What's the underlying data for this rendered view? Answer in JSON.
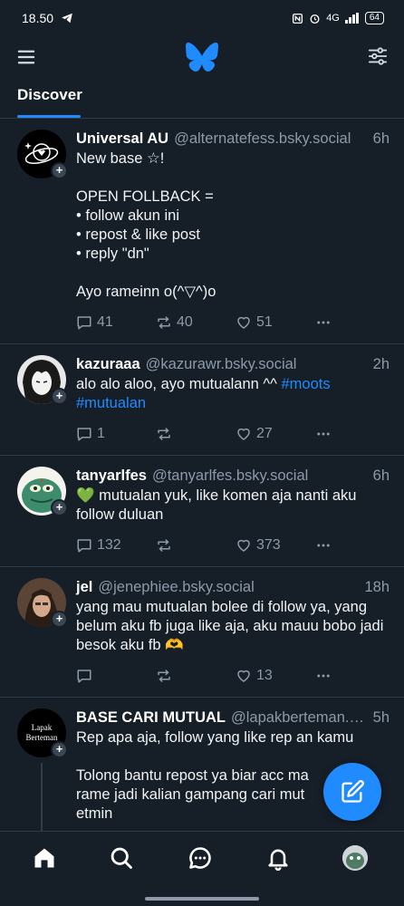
{
  "status_bar": {
    "time": "18.50",
    "network": "4G",
    "battery": "64"
  },
  "header": {
    "menu_icon": "hamburger-menu-icon",
    "logo": "butterfly-logo",
    "filter_icon": "sliders-icon"
  },
  "tabs": [
    {
      "label": "Discover",
      "active": true
    }
  ],
  "posts": [
    {
      "author": "Universal AU",
      "handle": "@alternatefess.bsky.social",
      "time": "6h",
      "text": "New base ☆!\n\nOPEN FOLLBACK =\n• follow akun ini\n• repost & like post\n• reply \"dn\"\n\nAyo rameinn o(^▽^)o",
      "replies": "41",
      "reposts": "40",
      "likes": "51"
    },
    {
      "author": "kazuraaa",
      "handle": "@kazurawr.bsky.social",
      "time": "2h",
      "text_before": "alo alo aloo, ayo mutualann ^^ ",
      "hashtag1": "#moots",
      "hashtag2": "#mutualan",
      "replies": "1",
      "reposts": "",
      "likes": "27"
    },
    {
      "author": "tanyarlfes",
      "handle": "@tanyarlfes.bsky.social",
      "time": "6h",
      "text": "💚 mutualan yuk, like komen aja nanti aku follow duluan",
      "replies": "132",
      "reposts": "",
      "likes": "373"
    },
    {
      "author": "jel",
      "handle": "@jenephiee.bsky.social",
      "time": "18h",
      "text": "yang mau mutualan bolee di follow ya, yang belum aku fb juga like aja, aku mauu bobo jadi besok aku fb 🫶",
      "replies": "",
      "reposts": "",
      "likes": "13"
    },
    {
      "author": "BASE CARI MUTUAL",
      "handle": "@lapakberteman.b...",
      "time": "5h",
      "avatar_text": "Lapak Berteman",
      "text": "Rep apa aja, follow yang like rep an kamu\n\nTolong bantu repost ya biar acc ma\nrame jadi kalian gampang cari mut\netmin"
    }
  ],
  "nav": [
    "home-icon",
    "search-icon",
    "chat-icon",
    "bell-icon",
    "profile-avatar"
  ],
  "colors": {
    "background": "#161e27",
    "accent": "#208bfe",
    "muted": "#8c9aaa",
    "divider": "#2e3b48"
  }
}
